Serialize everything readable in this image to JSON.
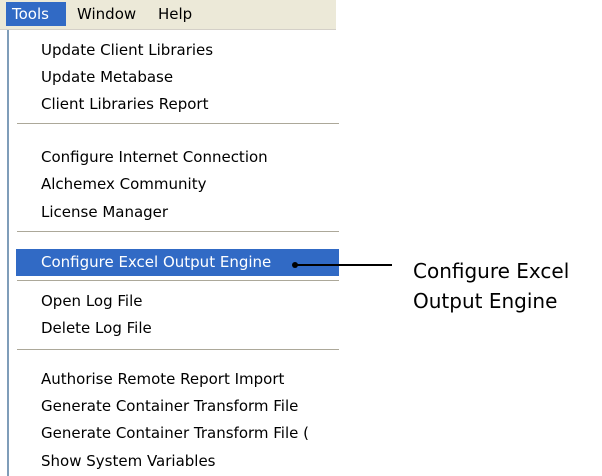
{
  "menubar": {
    "items": [
      {
        "label": "Tools"
      },
      {
        "label": "Window"
      },
      {
        "label": "Help"
      }
    ]
  },
  "tools_menu": {
    "group1": [
      "Update Client Libraries",
      "Update Metabase",
      "Client Libraries Report"
    ],
    "group2": [
      "Configure Internet Connection",
      "Alchemex Community",
      "License Manager"
    ],
    "group3": [
      "Configure Excel Output Engine"
    ],
    "group4": [
      "Open Log File",
      "Delete Log File"
    ],
    "group5": [
      "Authorise Remote Report Import",
      "Generate Container Transform File",
      "Generate Container Transform File (",
      "Show System Variables"
    ]
  },
  "highlighted_item": "Configure Excel Output Engine",
  "callout": {
    "line1": "Configure Excel",
    "line2": "Output Engine"
  },
  "colors": {
    "menubar_bg": "#ece9d8",
    "selection": "#316ac5"
  }
}
